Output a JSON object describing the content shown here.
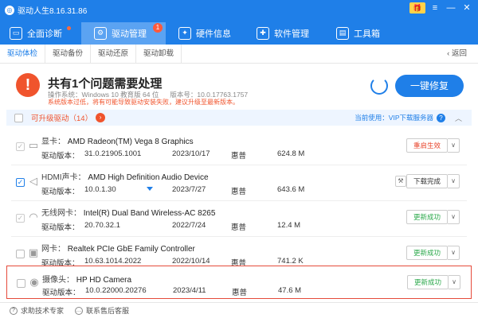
{
  "window": {
    "title": "驱动人生8.16.31.86",
    "logo_glyph": "◎"
  },
  "controls": {
    "gift": "🎁",
    "menu": "≡",
    "minimize": "—",
    "close": "✕"
  },
  "nav": [
    {
      "label": "全面诊断",
      "icon": "monitor-icon",
      "glyph": "▭"
    },
    {
      "label": "驱动管理",
      "icon": "gear-icon",
      "glyph": "⚙",
      "badge": "1"
    },
    {
      "label": "硬件信息",
      "icon": "chip-icon",
      "glyph": "✦"
    },
    {
      "label": "软件管理",
      "icon": "apps-icon",
      "glyph": "✚"
    },
    {
      "label": "工具箱",
      "icon": "toolbox-icon",
      "glyph": "▤"
    }
  ],
  "subtabs": [
    "驱动体检",
    "驱动备份",
    "驱动还原",
    "驱动卸载"
  ],
  "back_label": "返回",
  "summary": {
    "title": "共有1个问题需要处理",
    "os_label": "操作系统：Windows 10 教育版 64 位",
    "ver_label": "版本号：10.0.17763.1757",
    "warning": "系统版本过低，将有可能导致驱动安装失败，建议升级至最新版本。",
    "fix_button": "一键修复"
  },
  "list_header": {
    "upgradable": "可升级驱动（14）",
    "current_service": "当前使用：VIP下载服务器"
  },
  "column_labels": {
    "version_prefix": "驱动版本："
  },
  "drivers": [
    {
      "type": "显卡：",
      "name": "AMD Radeon(TM) Vega 8 Graphics",
      "version": "31.0.21905.1001",
      "date": "2023/10/17",
      "vendor": "惠普",
      "size": "624.8 M",
      "action": "重启生效",
      "action_color": "#e8452c",
      "icon": "gpu-icon",
      "checked": false
    },
    {
      "type": "HDMI声卡：",
      "name": "AMD High Definition Audio Device",
      "version": "10.0.1.30",
      "date": "2023/7/27",
      "vendor": "惠普",
      "size": "643.6 M",
      "action": "下载完成",
      "action_color": "#333333",
      "icon": "speaker-icon",
      "checked": true
    },
    {
      "type": "无线网卡：",
      "name": "Intel(R) Dual Band Wireless-AC 8265",
      "version": "20.70.32.1",
      "date": "2022/7/24",
      "vendor": "惠普",
      "size": "12.4 M",
      "action": "更新成功",
      "action_color": "#2aa84a",
      "icon": "wifi-icon",
      "checked": false
    },
    {
      "type": "网卡：",
      "name": "Realtek PCIe GbE Family Controller",
      "version": "10.63.1014.2022",
      "date": "2022/10/14",
      "vendor": "惠普",
      "size": "741.2 K",
      "action": "更新成功",
      "action_color": "#2aa84a",
      "icon": "network-icon",
      "checked": false
    },
    {
      "type": "摄像头：",
      "name": "HP HD Camera",
      "version": "10.0.22000.20276",
      "date": "2023/4/11",
      "vendor": "惠普",
      "size": "47.6 M",
      "action": "更新成功",
      "action_color": "#2aa84a",
      "icon": "camera-icon",
      "checked": false
    }
  ],
  "footer": [
    "求助技术专家",
    "联系售后客服"
  ]
}
